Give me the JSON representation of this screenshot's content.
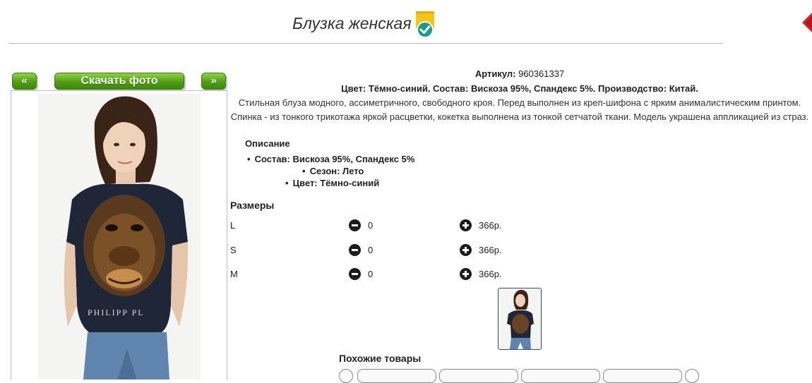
{
  "page": {
    "title": "Блузка женская"
  },
  "gallery": {
    "prev_label": "«",
    "download_label": "Скачать фото",
    "next_label": "»",
    "shirt_print_text": "PHILIPP PL"
  },
  "product": {
    "article_label": "Артикул:",
    "article_value": "960361337",
    "summary": "Цвет: Тёмно-синий. Состав: Вискоза 95%, Спандекс 5%. Производство: Китай.",
    "description": "Стильная блуза модного, ассиметричного, свободного кроя. Перед выполнен из креп-шифона с ярким анималистическим принтом. Спинка - из тонкого трикотажа яркой расцветки, кокетка выполнена из тонкой сетчатой ткани. Модель украшена аппликацией из страз.",
    "details_heading": "Описание",
    "details": [
      "Состав: Вискоза 95%, Спандекс 5%",
      "Сезон: Лето",
      "Цвет: Тёмно-синий"
    ]
  },
  "sizes": {
    "heading": "Размеры",
    "rows": [
      {
        "size": "L",
        "qty": "0",
        "price": "366р."
      },
      {
        "size": "S",
        "qty": "0",
        "price": "366р."
      },
      {
        "size": "M",
        "qty": "0",
        "price": "366р."
      }
    ]
  },
  "similar": {
    "heading": "Похожие товары"
  },
  "colors": {
    "button_green": "#4f9e14",
    "badge_yellow": "#f5c518",
    "badge_teal": "#1a9b8a",
    "close_red": "#d0252a",
    "thumb_border": "#2d4b7e"
  }
}
